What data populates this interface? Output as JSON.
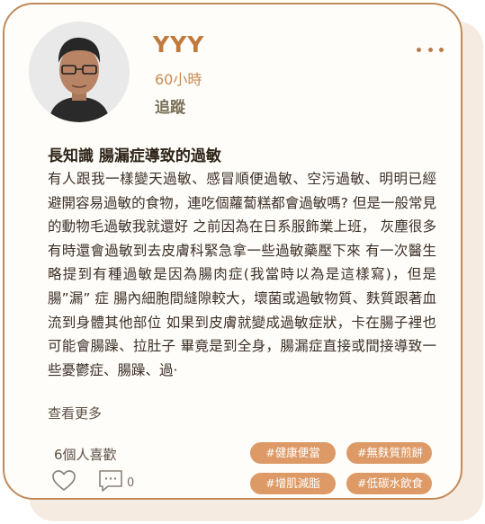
{
  "post": {
    "username": "YYY",
    "timestamp": "60小時",
    "follow_label": "追蹤",
    "title": "長知識 腸漏症導致的過敏",
    "body": "有人跟我一樣變天過敏、感冒順便過敏、空污過敏、明明已經避開容易過敏的食物，連吃個蘿蔔糕都會過敏嗎? 但是一般常見的動物毛過敏我就還好 之前因為在日系服飾業上班， 灰塵很多有時還會過敏到去皮膚科緊急拿一些過敏藥壓下來 有一次醫生略提到有種過敏是因為腸肉症(我當時以為是這樣寫)，但是腸”漏” 症 腸內細胞間縫隙較大，壞菌或過敏物質、麩質跟著血流到身體其他部位 如果到皮膚就變成過敏症狀，卡在腸子裡也可能會腸躁、拉肚子 畢竟是到全身，腸漏症直接或間接導致一些憂鬱症、腸躁、過·",
    "see_more_label": "查看更多",
    "likes_text": "6個人喜歡",
    "comment_count": "0",
    "tags": [
      "#健康便當",
      "#無麩質煎餅",
      "#增肌減脂",
      "#低碳水飲食"
    ]
  },
  "colors": {
    "accent": "#c07a3c",
    "tag_bg": "#dd9a66",
    "border": "#c08a5a",
    "card_bg": "#fffdf9",
    "shadow_bg": "#f5ebe1"
  },
  "icons": {
    "more": "more-dots-icon",
    "like": "heart-icon",
    "comment": "comment-icon"
  }
}
